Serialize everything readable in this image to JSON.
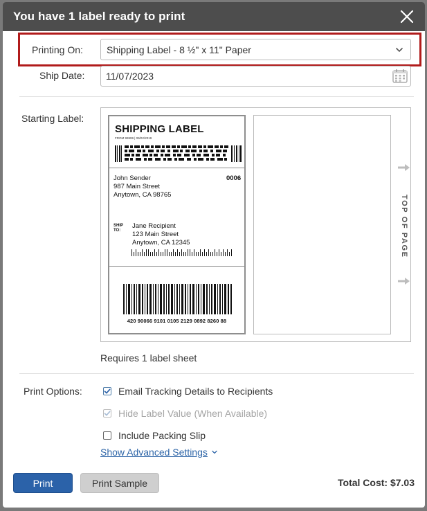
{
  "dialog": {
    "title": "You have 1 label ready to print"
  },
  "form": {
    "printing_on_label": "Printing On:",
    "printing_on_value": "Shipping Label - 8 ½\" x 11\" Paper",
    "ship_date_label": "Ship Date:",
    "ship_date_value": "11/07/2023",
    "starting_label_label": "Starting Label:"
  },
  "sample_label": {
    "title": "SHIPPING LABEL",
    "from_line": "FROM 99999  |  09/02/2019",
    "sender_lines": "John Sender\n987 Main Street\nAnytown, CA 98765",
    "number": "0006",
    "ship_to": "SHIP\nTO:",
    "recipient_lines": "Jane Recipient\n123 Main Street\nAnytown, CA 12345",
    "tracking_number": "420 90066 9101 0105 2129 0892 8260 88"
  },
  "top_of_page_text": "TOP OF PAGE",
  "requires_text": "Requires 1 label sheet",
  "print_options": {
    "label": "Print Options:",
    "items": [
      {
        "label": "Email Tracking Details to Recipients",
        "checked": true,
        "disabled": false
      },
      {
        "label": "Hide Label Value (When Available)",
        "checked": true,
        "disabled": true
      },
      {
        "label": "Include Packing Slip",
        "checked": false,
        "disabled": false
      }
    ],
    "advanced_link": "Show Advanced Settings"
  },
  "footer": {
    "print_button": "Print",
    "print_sample_button": "Print Sample",
    "total_cost": "Total Cost: $7.03"
  },
  "colors": {
    "titlebar": "#4d4d4d",
    "highlight_border": "#b11b1b",
    "primary_button": "#2b62a9",
    "link": "#2f66a8"
  }
}
